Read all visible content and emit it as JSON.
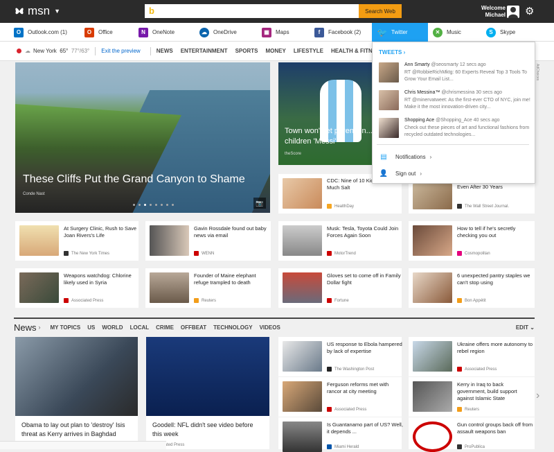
{
  "header": {
    "brand": "msn",
    "search_button": "Search Web",
    "welcome_line1": "Welcome",
    "welcome_line2": "Michael"
  },
  "apps": [
    {
      "label": "Outlook.com",
      "count": "(1)",
      "icon": "outlook-icon",
      "color": "#0072c6"
    },
    {
      "label": "Office",
      "count": "",
      "icon": "office-icon",
      "color": "#d83b01"
    },
    {
      "label": "OneNote",
      "count": "",
      "icon": "onenote-icon",
      "color": "#7719aa"
    },
    {
      "label": "OneDrive",
      "count": "",
      "icon": "onedrive-icon",
      "color": "#0a64ad"
    },
    {
      "label": "Maps",
      "count": "",
      "icon": "maps-icon",
      "color": "#a4267e"
    },
    {
      "label": "Facebook",
      "count": "(2)",
      "icon": "facebook-icon",
      "color": "#3b5998"
    },
    {
      "label": "Twitter",
      "count": "",
      "icon": "twitter-icon",
      "color": "#1ea1f2"
    },
    {
      "label": "Music",
      "count": "",
      "icon": "music-icon",
      "color": "#52b043"
    },
    {
      "label": "Skype",
      "count": "",
      "icon": "skype-icon",
      "color": "#00aff0"
    }
  ],
  "nav": {
    "city": "New York",
    "temp": "65°",
    "range": "77°/63°",
    "exit": "Exit the preview",
    "links": [
      "NEWS",
      "ENTERTAINMENT",
      "SPORTS",
      "MONEY",
      "LIFESTYLE",
      "HEALTH & FITNESS"
    ]
  },
  "hero": {
    "title": "These Cliffs Put the Grand Canyon to Shame",
    "source": "Conde Nast"
  },
  "messi": {
    "title": "Town won't let parents n... children 'Messi'",
    "source": "theScore"
  },
  "row1": [
    {
      "headline": "CDC: Nine of 10 Kids Eat Too Much Salt",
      "source": "HealthDay"
    },
    {
      "headline": "Even After 30 Years",
      "source": "The Wall Street Journal."
    }
  ],
  "row2": [
    {
      "headline": "At Surgery Clinic, Rush to Save Joan Rivers's Life",
      "source": "The New York Times"
    },
    {
      "headline": "Gavin Rossdale found out baby news via email",
      "source": "WENN"
    },
    {
      "headline": "Musk: Tesla, Toyota Could Join Forces Again Soon",
      "source": "MotorTrend"
    },
    {
      "headline": "How to tell if he's secretly checking you out",
      "source": "Cosmopolitan"
    }
  ],
  "row3": [
    {
      "headline": "Weapons watchdog: Chlorine likely used in Syria",
      "source": "Associated Press"
    },
    {
      "headline": "Founder of Maine elephant refuge trampled to death",
      "source": "Reuters"
    },
    {
      "headline": "Gloves set to come off in Family Dollar fight",
      "source": "Fortune"
    },
    {
      "headline": "6 unexpected pantry staples we can't stop using",
      "source": "Bon Appétit"
    }
  ],
  "newsbar": {
    "label": "News",
    "links": [
      "MY TOPICS",
      "US",
      "WORLD",
      "LOCAL",
      "CRIME",
      "OFFBEAT",
      "TECHNOLOGY",
      "VIDEOS"
    ],
    "edit": "EDIT"
  },
  "big1": {
    "headline": "Obama to lay out plan to 'destroy' Isis threat as Kerry arrives in Baghdad",
    "source": ""
  },
  "big2": {
    "headline": "Goodell: NFL didn't see video before this week",
    "source": "Associated Press"
  },
  "col3": [
    {
      "headline": "US response to Ebola hampered by lack of expertise",
      "source": "The Washington Post"
    },
    {
      "headline": "Ferguson reforms met with rancor at city meeting",
      "source": "Associated Press"
    },
    {
      "headline": "Is Guantanamo part of US? Well, it depends ...",
      "source": "Miami Herald"
    }
  ],
  "col4": [
    {
      "headline": "Ukraine offers more autonomy to rebel region",
      "source": "Associated Press"
    },
    {
      "headline": "Kerry in Iraq to back government, build support against Islamic State",
      "source": "Reuters"
    },
    {
      "headline": "Gun control groups back off from assault weapons ban",
      "source": "ProPublica"
    }
  ],
  "twitter": {
    "tweets_label": "TWEETS",
    "tweets": [
      {
        "name": "Ann Smarty",
        "handle": "@seosmarty 12 secs ago",
        "text": "RT @RobbieRichMktg: 60 Experts Reveal Top 3 Tools To Grow Your Email List..."
      },
      {
        "name": "Chris Messina™",
        "handle": "@chrismessina 30 secs ago",
        "text": "RT @minervatweet: As the first-ever CTO of NYC, join me! Make it the most innovation-driven city..."
      },
      {
        "name": "Shopping Ace",
        "handle": "@Shopping_Ace 40 secs ago",
        "text": "Check out these pieces of art and functional fashions from recycled outdated technologies..."
      }
    ],
    "notifications": "Notifications",
    "signout": "Sign out"
  },
  "adchoices": "AdChoices"
}
